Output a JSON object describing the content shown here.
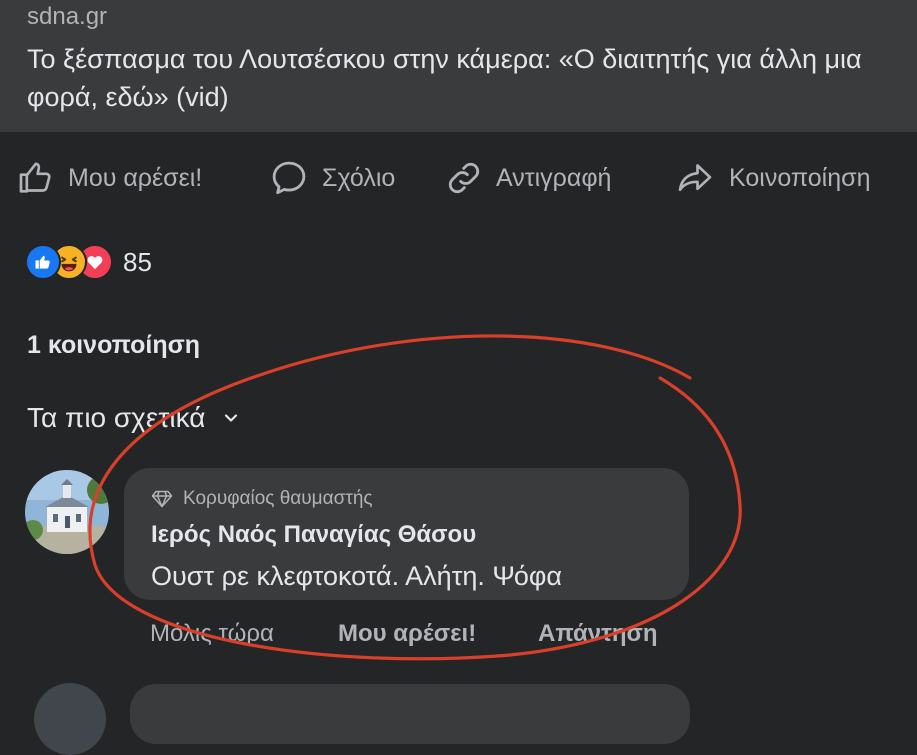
{
  "link_preview": {
    "domain": "sdna.gr",
    "title": "Το ξέσπασμα του Λουτσέσκου στην κάμερα: «Ο διαιτητής για άλλη μια φορά, εδώ» (vid)"
  },
  "actions": {
    "like": "Μου αρέσει!",
    "comment": "Σχόλιο",
    "copy": "Αντιγραφή",
    "share": "Κοινοποίηση"
  },
  "reactions": {
    "types": [
      "like-icon",
      "haha-icon",
      "love-icon"
    ],
    "count": "85"
  },
  "shares": "1 κοινοποίηση",
  "sort": {
    "label": "Τα πιο σχετικά"
  },
  "comment": {
    "badge": "Κορυφαίος θαυμαστής",
    "author": "Ιερός Ναός Παναγίας Θάσου",
    "text": "Ουστ ρε κλεφτοκοτά. Αλήτη. Ψόφα",
    "time": "Μόλις τώρα",
    "like": "Μου αρέσει!",
    "reply": "Απάντηση"
  },
  "colors": {
    "background": "#242526",
    "card": "#3a3b3c",
    "text_primary": "#e4e6eb",
    "text_secondary": "#b0b3b8",
    "annotation": "#d9402b",
    "like_blue": "#1877f2",
    "love_red": "#f33e58",
    "haha_yellow": "#f7b125"
  }
}
